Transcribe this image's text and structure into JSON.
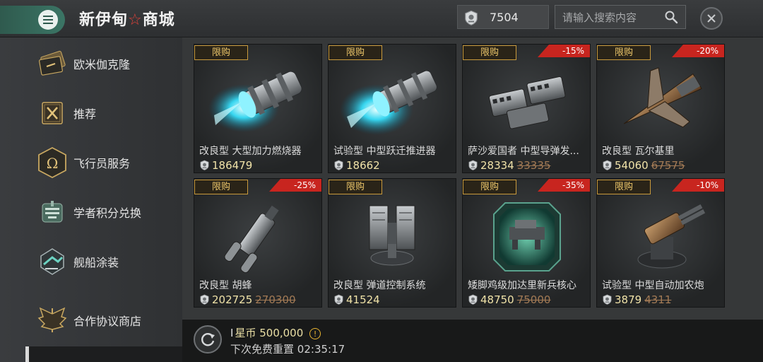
{
  "header": {
    "title_part1": "新伊甸",
    "title_star": "☆",
    "title_part2": "商城",
    "currency_value": "7504",
    "search_placeholder": "请输入搜索内容"
  },
  "sidebar": {
    "items": [
      {
        "label": "欧米伽克隆",
        "icon": "omega-clone-card-icon"
      },
      {
        "label": "推荐",
        "icon": "recommend-x-icon"
      },
      {
        "label": "飞行员服务",
        "icon": "omega-pilot-icon"
      },
      {
        "label": "学者积分兑换",
        "icon": "scholar-points-icon"
      },
      {
        "label": "舰船涂装",
        "icon": "ship-skin-icon"
      },
      {
        "label": "合作协议商店",
        "icon": "cooperation-wings-icon"
      }
    ]
  },
  "products": [
    {
      "badge": "限购",
      "discount": "",
      "name": "改良型 大型加力燃烧器",
      "price": "186479",
      "old_price": "",
      "art": "afterburner-icon"
    },
    {
      "badge": "限购",
      "discount": "",
      "name": "试验型 中型跃迁推进器",
      "price": "18662",
      "old_price": "",
      "art": "warp-thruster-icon"
    },
    {
      "badge": "限购",
      "discount": "-15%",
      "name": "萨沙爱国者 中型导弹发...",
      "price": "28334",
      "old_price": "33335",
      "art": "missile-launcher-icon"
    },
    {
      "badge": "限购",
      "discount": "-20%",
      "name": "改良型 瓦尔基里",
      "price": "54060",
      "old_price": "67575",
      "art": "valkyrie-fighter-icon"
    },
    {
      "badge": "限购",
      "discount": "-25%",
      "name": "改良型 胡蜂",
      "price": "202725",
      "old_price": "270300",
      "art": "hornet-drone-icon"
    },
    {
      "badge": "限购",
      "discount": "",
      "name": "改良型 弹道控制系统",
      "price": "41524",
      "old_price": "",
      "art": "ballistic-control-icon"
    },
    {
      "badge": "限购",
      "discount": "-35%",
      "name": "矮脚鸡级加达里新兵核心",
      "price": "48750",
      "old_price": "75000",
      "art": "recruit-core-icon"
    },
    {
      "badge": "限购",
      "discount": "-10%",
      "name": "试验型 中型自动加农炮",
      "price": "3879",
      "old_price": "4311",
      "art": "autocannon-icon"
    }
  ],
  "footer": {
    "coin_bar": "I",
    "coin_label": "星币",
    "coin_value": "500,000",
    "warn": "!",
    "reset_label": "下次免费重置",
    "reset_time": "02:35:17"
  },
  "colors": {
    "accent_green": "#3b7565",
    "discount_red": "#c8251f",
    "badge_gold": "#ecc66a",
    "price_gold": "#f0e2a8"
  }
}
